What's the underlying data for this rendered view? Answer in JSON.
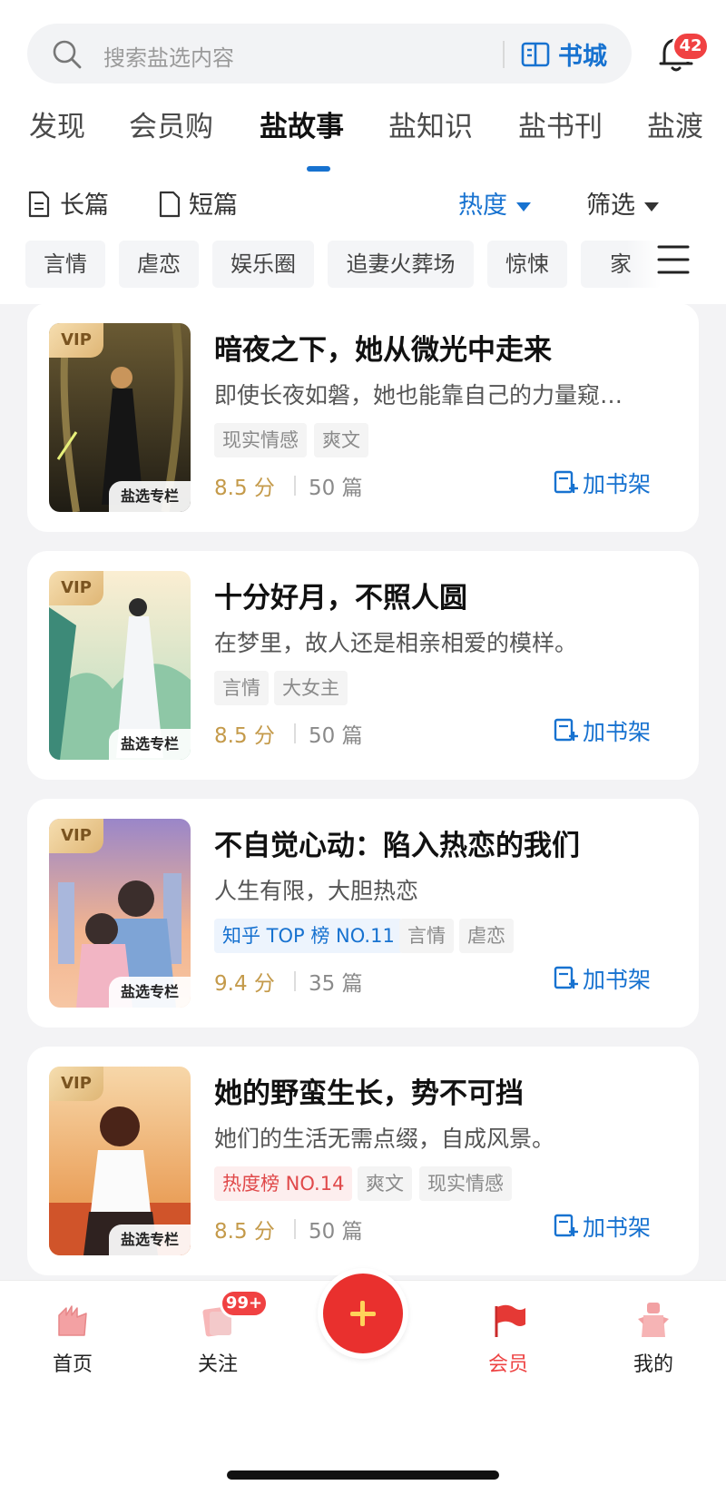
{
  "search": {
    "placeholder": "搜索盐选内容",
    "book_city": "书城"
  },
  "notifications": {
    "badge": "42"
  },
  "tabs": [
    {
      "label": "发现"
    },
    {
      "label": "会员购"
    },
    {
      "label": "盐故事",
      "active": true
    },
    {
      "label": "盐知识"
    },
    {
      "label": "盐书刊"
    },
    {
      "label": "盐渡"
    }
  ],
  "filters": {
    "long": "长篇",
    "short": "短篇",
    "sort": "热度",
    "filter": "筛选"
  },
  "chips": [
    "言情",
    "虐恋",
    "娱乐圈",
    "追妻火葬场",
    "惊悚",
    "家"
  ],
  "stories": [
    {
      "title": "暗夜之下，她从微光中走来",
      "desc": "即使长夜如磐，她也能靠自己的力量窥…",
      "tags": [
        {
          "text": "现实情感",
          "style": "gray"
        },
        {
          "text": "爽文",
          "style": "gray"
        }
      ],
      "score": "8.5 分",
      "count": "50 篇",
      "vip": "VIP",
      "column": "盐选专栏",
      "add": "加书架"
    },
    {
      "title": "十分好月，不照人圆",
      "desc": "在梦里，故人还是相亲相爱的模样。",
      "tags": [
        {
          "text": "言情",
          "style": "gray"
        },
        {
          "text": "大女主",
          "style": "gray"
        }
      ],
      "score": "8.5 分",
      "count": "50 篇",
      "vip": "VIP",
      "column": "盐选专栏",
      "add": "加书架"
    },
    {
      "title": "不自觉心动：陷入热恋的我们",
      "desc": "人生有限，大胆热恋",
      "tags": [
        {
          "text": "知乎 TOP 榜 NO.11",
          "style": "blue"
        },
        {
          "text": "言情",
          "style": "gray"
        },
        {
          "text": "虐恋",
          "style": "gray"
        }
      ],
      "score": "9.4 分",
      "count": "35 篇",
      "vip": "VIP",
      "column": "盐选专栏",
      "add": "加书架"
    },
    {
      "title": "她的野蛮生长，势不可挡",
      "desc": "她们的生活无需点缀，自成风景。",
      "tags": [
        {
          "text": "热度榜 NO.14",
          "style": "red"
        },
        {
          "text": "爽文",
          "style": "gray"
        },
        {
          "text": "现实情感",
          "style": "gray"
        }
      ],
      "score": "8.5 分",
      "count": "50 篇",
      "vip": "VIP",
      "column": "盐选专栏",
      "add": "加书架"
    }
  ],
  "bottom_nav": {
    "home": "首页",
    "follow": "关注",
    "follow_badge": "99+",
    "member": "会员",
    "me": "我的"
  },
  "colors": {
    "accent": "#1772d0",
    "badge": "#f04142",
    "fab": "#e9302e",
    "score": "#c49a4a"
  }
}
